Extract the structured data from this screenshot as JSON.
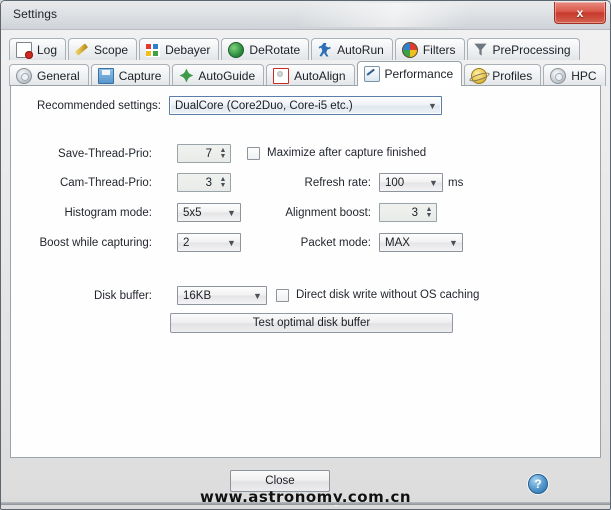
{
  "window": {
    "title": "Settings",
    "close_label": "x"
  },
  "tabs": {
    "row1": [
      {
        "label": "Log",
        "icon": "log-icon"
      },
      {
        "label": "Scope",
        "icon": "scope-icon"
      },
      {
        "label": "Debayer",
        "icon": "debayer-icon"
      },
      {
        "label": "DeRotate",
        "icon": "derotate-icon"
      },
      {
        "label": "AutoRun",
        "icon": "autorun-icon"
      },
      {
        "label": "Filters",
        "icon": "filters-icon"
      },
      {
        "label": "PreProcessing",
        "icon": "preprocessing-icon"
      }
    ],
    "row2": [
      {
        "label": "General",
        "icon": "general-icon"
      },
      {
        "label": "Capture",
        "icon": "capture-icon"
      },
      {
        "label": "AutoGuide",
        "icon": "autoguide-icon"
      },
      {
        "label": "AutoAlign",
        "icon": "autoalign-icon"
      },
      {
        "label": "Performance",
        "icon": "performance-icon"
      },
      {
        "label": "Profiles",
        "icon": "profiles-icon"
      },
      {
        "label": "HPC",
        "icon": "hpc-icon"
      }
    ],
    "active": "Performance"
  },
  "form": {
    "recommended_settings": {
      "label": "Recommended settings:",
      "value": "DualCore (Core2Duo, Core-i5 etc.)"
    },
    "save_thread_prio": {
      "label": "Save-Thread-Prio:",
      "value": "7"
    },
    "maximize_after_capture": {
      "label": "Maximize after capture finished",
      "checked": false
    },
    "cam_thread_prio": {
      "label": "Cam-Thread-Prio:",
      "value": "3"
    },
    "refresh_rate": {
      "label": "Refresh rate:",
      "value": "100",
      "unit": "ms"
    },
    "histogram_mode": {
      "label": "Histogram mode:",
      "value": "5x5"
    },
    "alignment_boost": {
      "label": "Alignment boost:",
      "value": "3"
    },
    "boost_while_capturing": {
      "label": "Boost while capturing:",
      "value": "2"
    },
    "packet_mode": {
      "label": "Packet mode:",
      "value": "MAX"
    },
    "disk_buffer": {
      "label": "Disk buffer:",
      "value": "16KB"
    },
    "direct_disk_write": {
      "label": "Direct disk write without OS caching",
      "checked": false
    },
    "test_optimal_disk_buffer": {
      "label": "Test optimal disk buffer"
    }
  },
  "footer": {
    "close_label": "Close",
    "help_label": "?",
    "watermark": "www.astronomy.com.cn"
  },
  "colors": {
    "accent": "#2a6ea8",
    "close_red": "#c7392c",
    "panel_bg": "#fefeff",
    "window_bg": "#e6e6e6"
  }
}
